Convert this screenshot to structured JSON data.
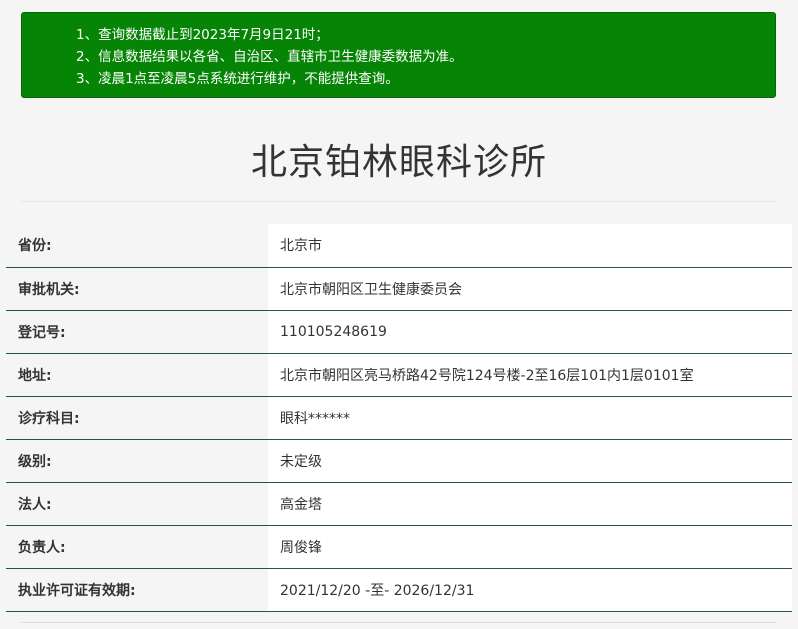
{
  "notice": {
    "lines": [
      "1、查询数据截止到2023年7月9日21时；",
      "2、信息数据结果以各省、自治区、直辖市卫生健康委数据为准。",
      "3、凌晨1点至凌晨5点系统进行维护，不能提供查询。"
    ]
  },
  "page_title": "北京铂林眼科诊所",
  "info_rows": [
    {
      "label": "省份:",
      "value": "北京市"
    },
    {
      "label": "审批机关:",
      "value": "北京市朝阳区卫生健康委员会"
    },
    {
      "label": "登记号:",
      "value": "110105248619"
    },
    {
      "label": "地址:",
      "value": "北京市朝阳区亮马桥路42号院124号楼-2至16层101内1层0101室"
    },
    {
      "label": "诊疗科目:",
      "value": "眼科******"
    },
    {
      "label": "级别:",
      "value": "未定级"
    },
    {
      "label": "法人:",
      "value": "高金塔"
    },
    {
      "label": "负责人:",
      "value": "周俊锋"
    },
    {
      "label": "执业许可证有效期:",
      "value": "2021/12/20 -至- 2026/12/31"
    }
  ],
  "colors": {
    "notice_background": "#068406",
    "row_divider": "#1d5a35",
    "page_background": "#f5f5f5"
  }
}
